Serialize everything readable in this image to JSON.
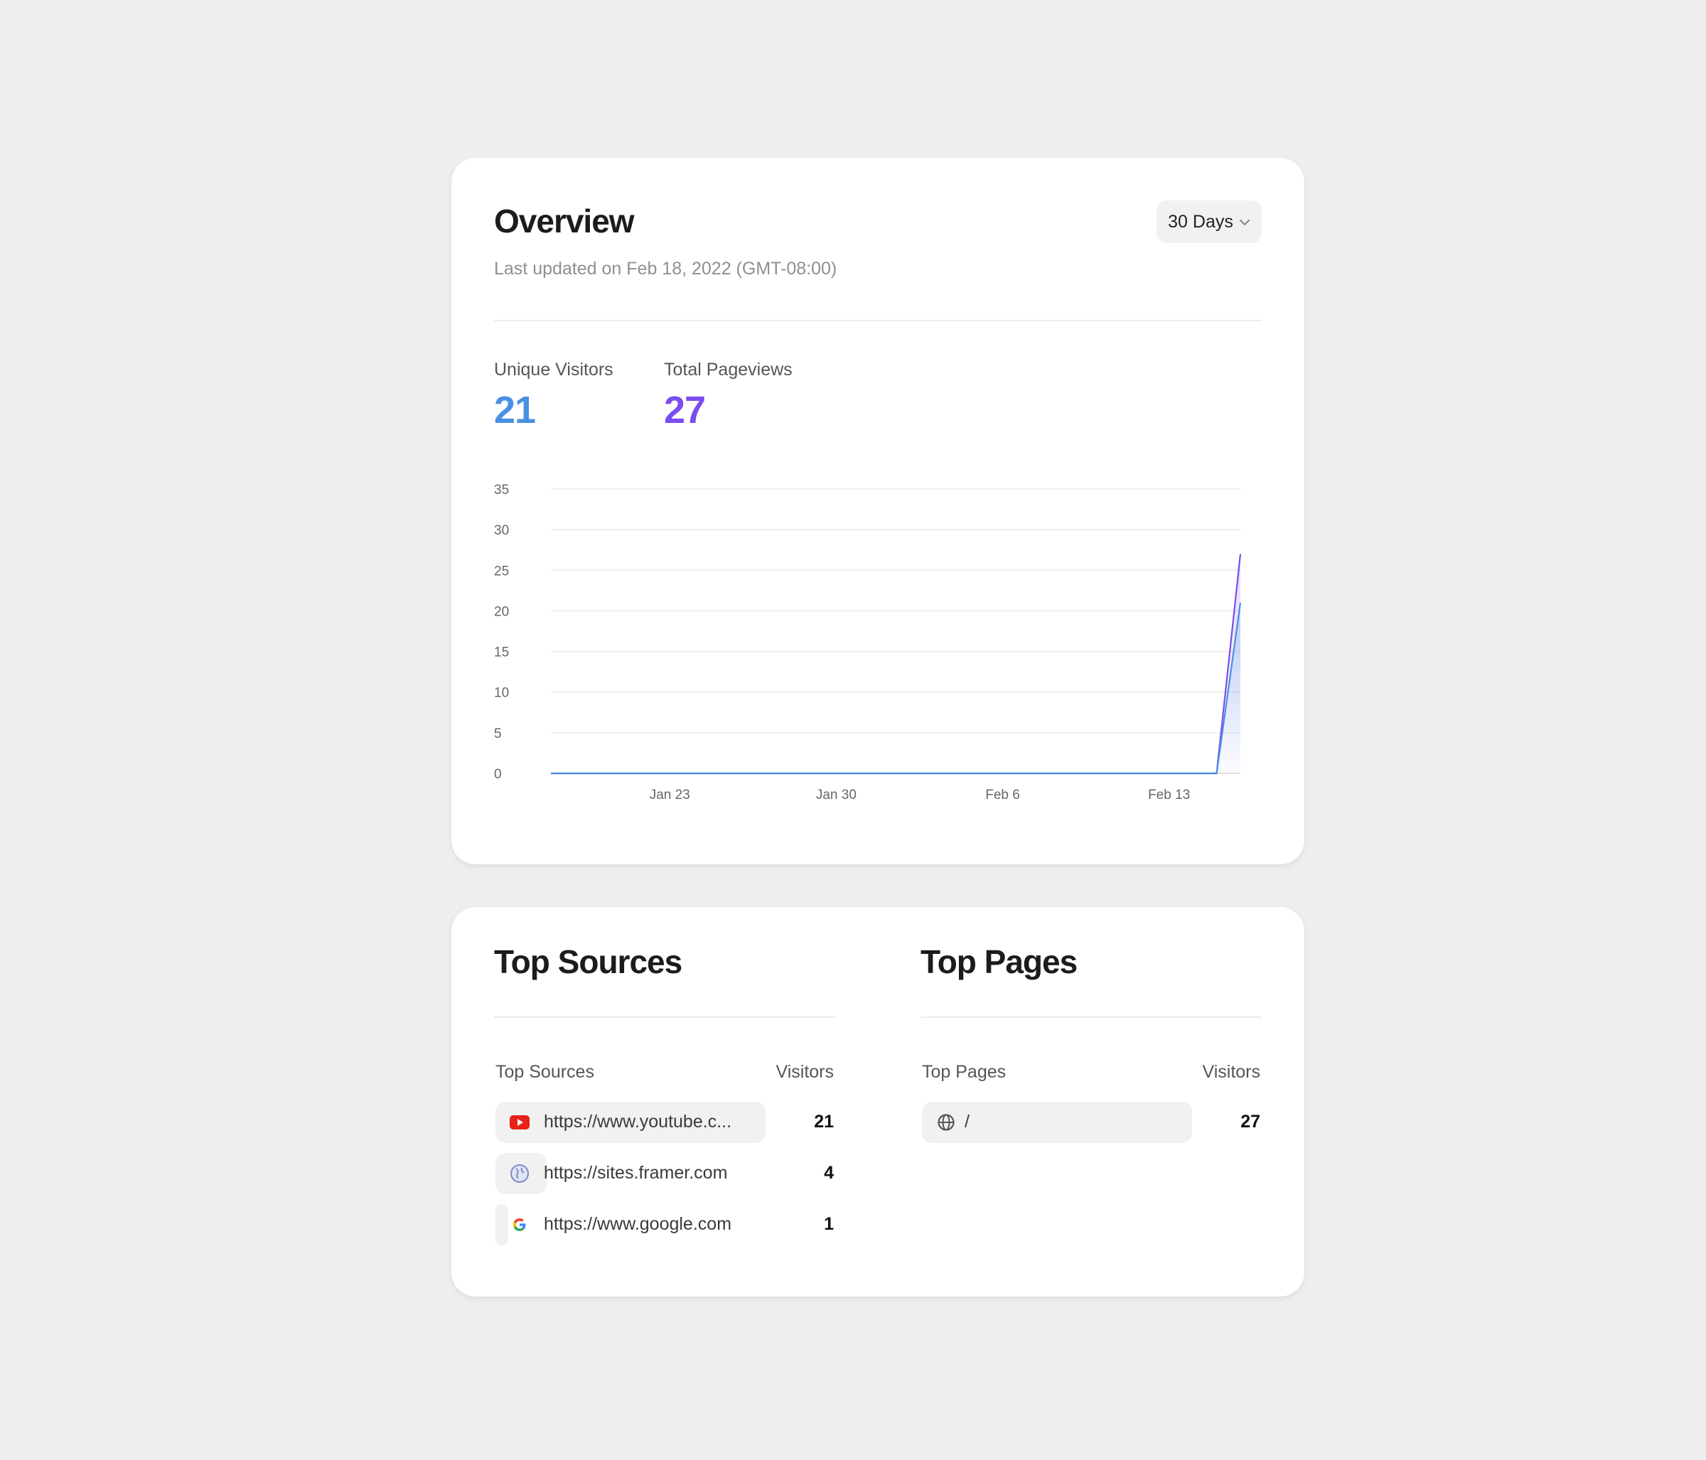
{
  "overview": {
    "title": "Overview",
    "subtitle": "Last updated on Feb 18, 2022 (GMT-08:00)",
    "range_label": "30 Days",
    "stats": [
      {
        "label": "Unique Visitors",
        "value": "21",
        "color": "#4a90e2"
      },
      {
        "label": "Total Pageviews",
        "value": "27",
        "color": "#7b4cf0"
      }
    ]
  },
  "chart_data": {
    "type": "area",
    "x_tick_labels": [
      "Jan 23",
      "Jan 30",
      "Feb 6",
      "Feb 13"
    ],
    "x_tick_days": [
      5,
      12,
      19,
      26
    ],
    "days": 30,
    "ylim": [
      0,
      35
    ],
    "y_ticks": [
      "35",
      "30",
      "25",
      "20",
      "15",
      "10",
      "5",
      "0"
    ],
    "grid": true,
    "series": [
      {
        "values": [
          0,
          0,
          0,
          0,
          0,
          0,
          0,
          0,
          0,
          0,
          0,
          0,
          0,
          0,
          0,
          0,
          0,
          0,
          0,
          0,
          0,
          0,
          0,
          0,
          0,
          0,
          0,
          0,
          0,
          27
        ],
        "color": "#7b4cf0"
      },
      {
        "values": [
          0,
          0,
          0,
          0,
          0,
          0,
          0,
          0,
          0,
          0,
          0,
          0,
          0,
          0,
          0,
          0,
          0,
          0,
          0,
          0,
          0,
          0,
          0,
          0,
          0,
          0,
          0,
          0,
          0,
          21
        ],
        "color": "#4a90e2"
      }
    ]
  },
  "top_sources": {
    "title": "Top Sources",
    "col_label": "Top Sources",
    "col_value": "Visitors",
    "rows": [
      {
        "label": "https://www.youtube.c...",
        "value": "21",
        "icon": "youtube-icon"
      },
      {
        "label": "https://sites.framer.com",
        "value": "4",
        "icon": "framer-globe-icon"
      },
      {
        "label": "https://www.google.com",
        "value": "1",
        "icon": "google-icon"
      }
    ]
  },
  "top_pages": {
    "title": "Top Pages",
    "col_label": "Top Pages",
    "col_value": "Visitors",
    "rows": [
      {
        "label": "/",
        "value": "27",
        "icon": "globe-icon"
      }
    ]
  }
}
